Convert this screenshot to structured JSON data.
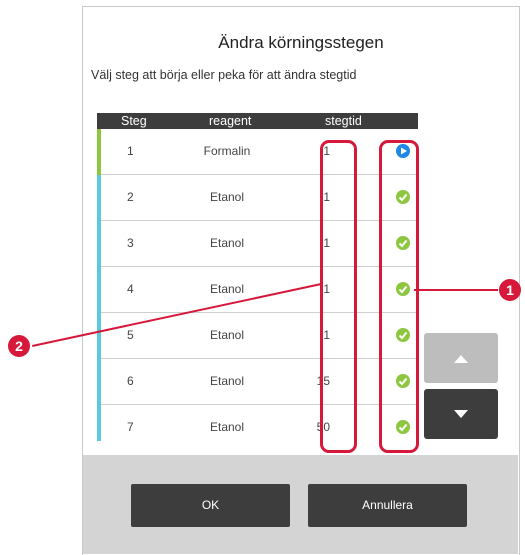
{
  "dialog": {
    "title": "Ändra körningsstegen",
    "subtitle": "Välj steg att börja eller peka för att ändra stegtid"
  },
  "table": {
    "headers": {
      "steg": "Steg",
      "reagent": "reagent",
      "stegtid": "stegtid"
    },
    "rows": [
      {
        "steg": "1",
        "reagent": "Formalin",
        "stegtid": "1",
        "status": "play-icon",
        "color": "#8dc63f"
      },
      {
        "steg": "2",
        "reagent": "Etanol",
        "stegtid": "1",
        "status": "check-icon",
        "color": "#5bc8dc"
      },
      {
        "steg": "3",
        "reagent": "Etanol",
        "stegtid": "1",
        "status": "check-icon",
        "color": "#5bc8dc"
      },
      {
        "steg": "4",
        "reagent": "Etanol",
        "stegtid": "1",
        "status": "check-icon",
        "color": "#5bc8dc"
      },
      {
        "steg": "5",
        "reagent": "Etanol",
        "stegtid": "1",
        "status": "check-icon",
        "color": "#5bc8dc"
      },
      {
        "steg": "6",
        "reagent": "Etanol",
        "stegtid": "15",
        "status": "check-icon",
        "color": "#5bc8dc"
      },
      {
        "steg": "7",
        "reagent": "Etanol",
        "stegtid": "50",
        "status": "check-icon",
        "color": "#5bc8dc"
      },
      {
        "steg": "",
        "reagent": "",
        "stegtid": "",
        "status": "check-icon",
        "color": "#e0338a"
      }
    ]
  },
  "callouts": {
    "one": "1",
    "two": "2",
    "color": "#d6193b"
  },
  "scroll": {
    "up": "chevron-up-icon",
    "down": "chevron-down-icon"
  },
  "buttons": {
    "ok": "OK",
    "cancel": "Annullera"
  },
  "colors": {
    "accent": "#d6193b",
    "dark": "#3d3d3d",
    "check": "#8dc63f",
    "play": "#1e88e5"
  }
}
